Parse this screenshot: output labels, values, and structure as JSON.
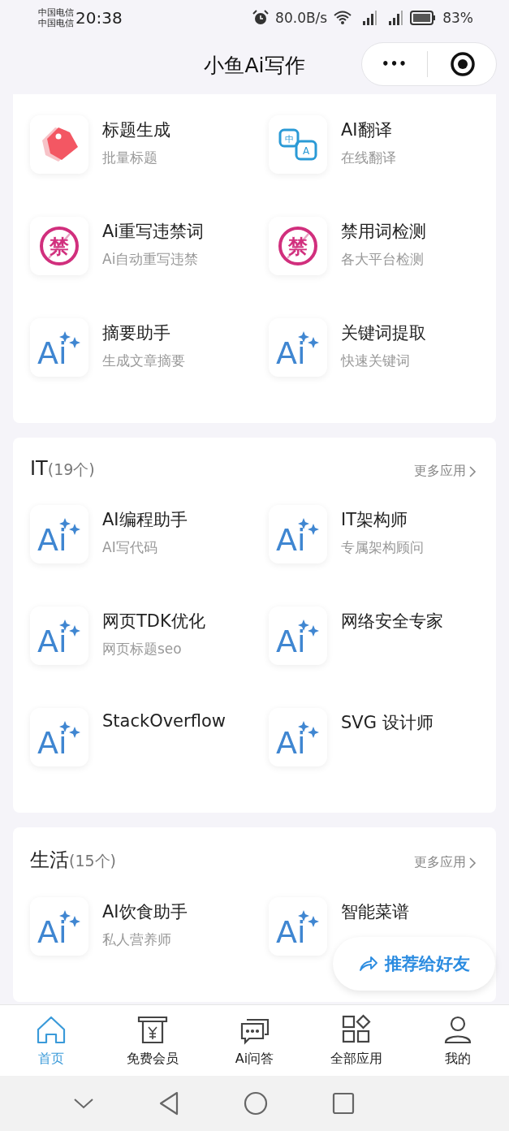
{
  "status_bar": {
    "carriers": [
      "中国电信",
      "中国电信"
    ],
    "time": "20:38",
    "speed": "80.0B/s",
    "battery": "83%"
  },
  "nav": {
    "title": "小鱼Ai写作",
    "more": "•••"
  },
  "sections": [
    {
      "items": [
        {
          "title": "标题生成",
          "subtitle": "批量标题",
          "icon": {
            "kind": "tag"
          }
        },
        {
          "title": "AI翻译",
          "subtitle": "在线翻译",
          "icon": {
            "kind": "translate",
            "texts": [
              "中",
              "A"
            ]
          }
        },
        {
          "title": "Ai重写违禁词",
          "subtitle": "Ai自动重写违禁",
          "icon": {
            "kind": "ban",
            "text": "禁"
          }
        },
        {
          "title": "禁用词检测",
          "subtitle": "各大平台检测",
          "icon": {
            "kind": "ban",
            "text": "禁"
          }
        },
        {
          "title": "摘要助手",
          "subtitle": "生成文章摘要",
          "icon": {
            "kind": "ai",
            "text": "Ai"
          }
        },
        {
          "title": "关键词提取",
          "subtitle": "快速关键词",
          "icon": {
            "kind": "ai",
            "text": "Ai"
          }
        }
      ]
    },
    {
      "title": "IT",
      "count": "(19个)",
      "more": "更多应用",
      "items": [
        {
          "title": "AI编程助手",
          "subtitle": "AI写代码",
          "icon": {
            "kind": "ai",
            "text": "Ai"
          }
        },
        {
          "title": "IT架构师",
          "subtitle": "专属架构顾问",
          "icon": {
            "kind": "ai",
            "text": "Ai"
          }
        },
        {
          "title": "网页TDK优化",
          "subtitle": "网页标题seo",
          "icon": {
            "kind": "ai",
            "text": "Ai"
          }
        },
        {
          "title": "网络安全专家",
          "icon": {
            "kind": "ai",
            "text": "Ai"
          }
        },
        {
          "title": "StackOverflow",
          "icon": {
            "kind": "ai",
            "text": "Ai"
          }
        },
        {
          "title": "SVG 设计师",
          "icon": {
            "kind": "ai",
            "text": "Ai"
          }
        }
      ]
    },
    {
      "title": "生活",
      "count": "(15个)",
      "more": "更多应用",
      "items": [
        {
          "title": "AI饮食助手",
          "subtitle": "私人营养师",
          "icon": {
            "kind": "ai",
            "text": "Ai"
          }
        },
        {
          "title": "智能菜谱",
          "icon": {
            "kind": "ai",
            "text": "Ai"
          }
        }
      ]
    }
  ],
  "share_button": {
    "label": "推荐给好友"
  },
  "tabbar": [
    {
      "label": "首页",
      "selected": true
    },
    {
      "label": "免费会员",
      "selected": false
    },
    {
      "label": "Ai问答",
      "selected": false
    },
    {
      "label": "全部应用",
      "selected": false
    },
    {
      "label": "我的",
      "selected": false
    }
  ]
}
